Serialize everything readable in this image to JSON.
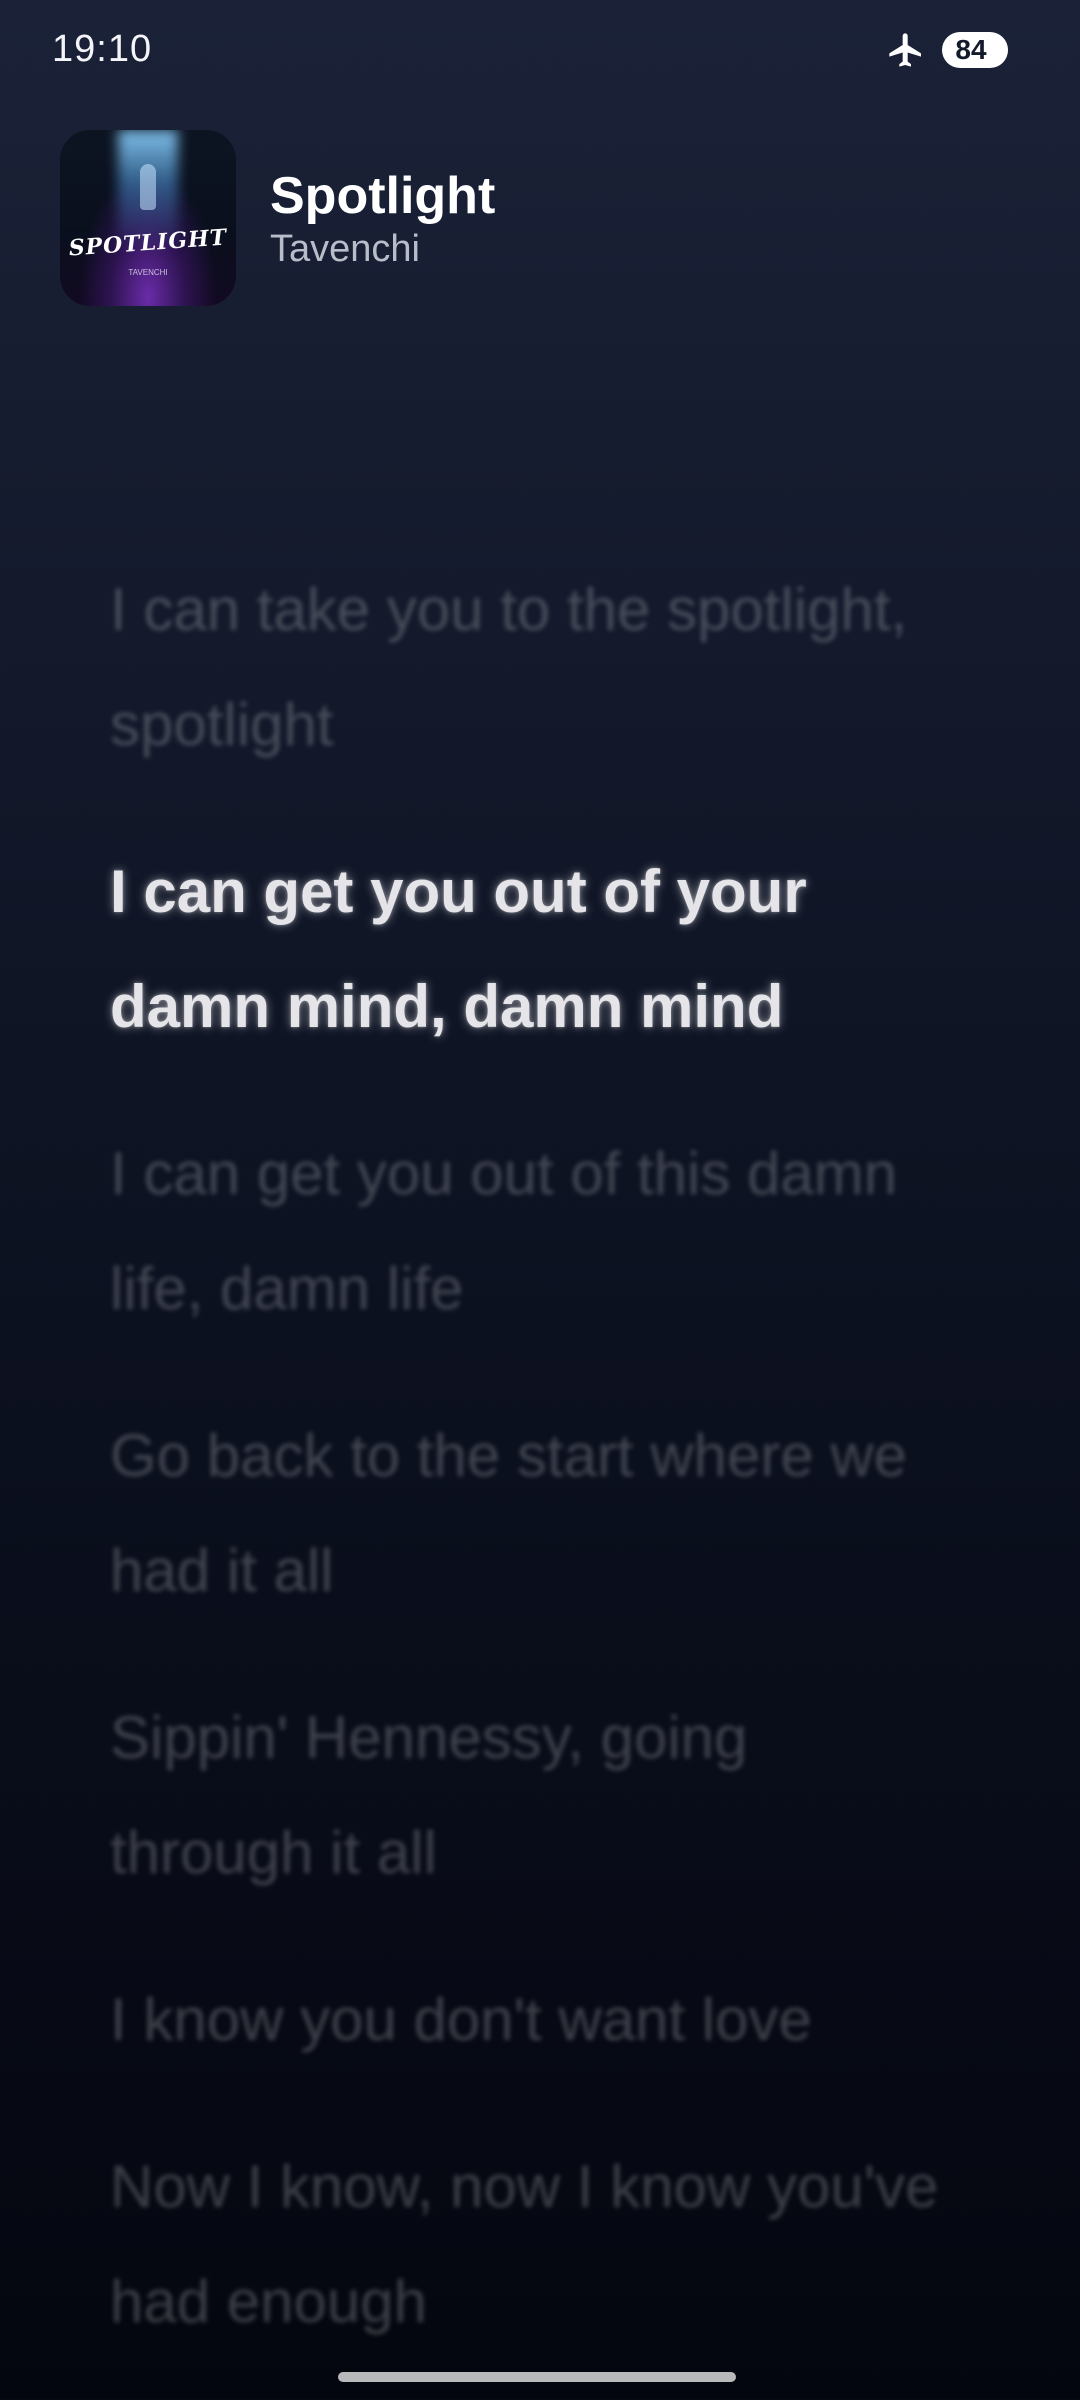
{
  "status_bar": {
    "time": "19:10",
    "airplane_icon": "airplane-icon",
    "battery_level": "84",
    "battery_fraction": 0.84
  },
  "now_playing": {
    "album_art": {
      "art_text": "SPOTLIGHT",
      "art_subtext": "TAVENCHI"
    },
    "title": "Spotlight",
    "artist": "Tavenchi"
  },
  "lyrics": {
    "active_index": 1,
    "lines": [
      "I can take you to the spotlight, spotlight",
      "I can get you out of your damn mind, damn mind",
      "I can get you out of this damn life, damn life",
      "Go back to the start where we had it all",
      "Sippin' Hennessy, going through it all",
      "I know you don't want love",
      "Now I know, now I know you've had enough"
    ]
  },
  "colors": {
    "background_top": "#1b2238",
    "background_bottom": "#04060f",
    "active_lyric": "#e4e4e9",
    "inactive_lyric": "rgba(255,255,255,0.22)",
    "artist_text": "#b9bdc9"
  }
}
